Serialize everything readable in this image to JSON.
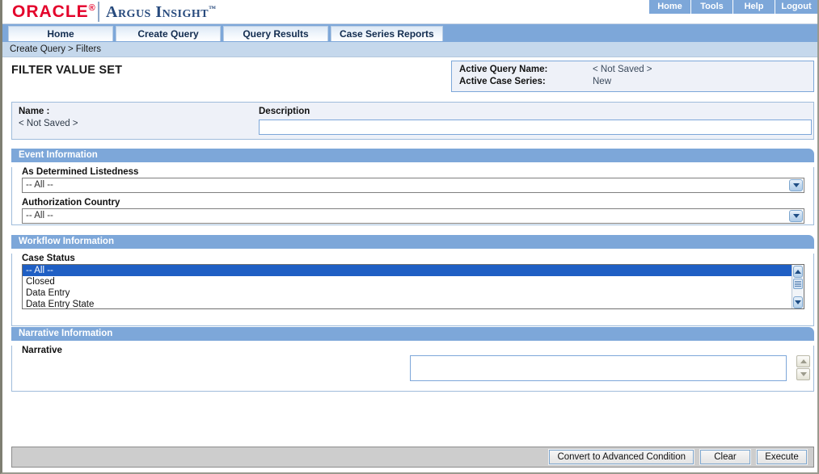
{
  "brand": {
    "oracle": "ORACLE",
    "registered": "®",
    "product": "Argus Insight",
    "tm": "™"
  },
  "topnav": {
    "items": [
      {
        "label": "Home",
        "name": "topnav-home"
      },
      {
        "label": "Tools",
        "name": "topnav-tools"
      },
      {
        "label": "Help",
        "name": "topnav-help"
      },
      {
        "label": "Logout",
        "name": "topnav-logout"
      }
    ]
  },
  "tabs": [
    {
      "label": "Home"
    },
    {
      "label": "Create Query"
    },
    {
      "label": "Query Results"
    },
    {
      "label": "Case Series Reports"
    }
  ],
  "breadcrumb": {
    "parent": "Create Query",
    "separator": ">",
    "current": "Filters"
  },
  "page": {
    "title": "FILTER VALUE SET"
  },
  "active_info": {
    "query_name_label": "Active Query Name:",
    "query_name_value": "< Not Saved >",
    "case_series_label": "Active Case Series:",
    "case_series_value": "New"
  },
  "name_section": {
    "name_label": "Name :",
    "name_value": "< Not Saved >",
    "description_label": "Description",
    "description_value": "",
    "description_placeholder": ""
  },
  "sections": {
    "event": {
      "title": "Event Information",
      "listedness_label": "As Determined Listedness",
      "listedness_value": "-- All --",
      "listedness_options": [
        "-- All --"
      ],
      "country_label": "Authorization Country",
      "country_value": "-- All --",
      "country_options": [
        "-- All --"
      ]
    },
    "workflow": {
      "title": "Workflow Information",
      "case_status_label": "Case Status",
      "case_status_options": [
        {
          "label": "-- All --",
          "selected": true
        },
        {
          "label": "Closed",
          "selected": false
        },
        {
          "label": "Data Entry",
          "selected": false
        },
        {
          "label": "Data Entry State",
          "selected": false
        }
      ]
    },
    "narrative": {
      "title": "Narrative Information",
      "narrative_label": "Narrative",
      "narrative_value": "",
      "narrative_placeholder": ""
    }
  },
  "footer": {
    "buttons": [
      {
        "label": "Convert to Advanced Condition",
        "name": "convert-to-advanced-condition-button"
      },
      {
        "label": "Clear",
        "name": "clear-button"
      },
      {
        "label": "Execute",
        "name": "execute-button"
      }
    ]
  },
  "colors": {
    "oracle_red": "#e4022b",
    "brand_blue": "#274a7d",
    "header_blue": "#7da7d9",
    "breadcrumb_blue": "#c5d8ec",
    "selection_blue": "#1f5fc4",
    "panel_bg": "#eef1f8",
    "footer_gray": "#cdcdcd"
  }
}
